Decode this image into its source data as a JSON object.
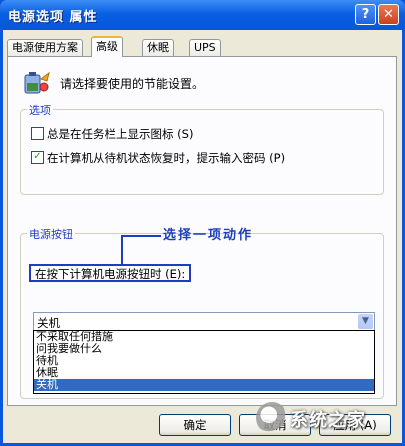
{
  "window": {
    "title": "电源选项 属性"
  },
  "tabs": [
    "电源使用方案",
    "高级",
    "休眠",
    "UPS"
  ],
  "active_tab": 1,
  "intro_text": "请选择要使用的节能设置。",
  "options_group": {
    "title": "选项",
    "items": [
      {
        "label": "总是在任务栏上显示图标 (S)",
        "checked": false,
        "mark": ""
      },
      {
        "label": "在计算机从待机状态恢复时，提示输入密码 (P)",
        "checked": true,
        "mark": "✓"
      }
    ]
  },
  "power_button_group": {
    "title": "电源按钮",
    "annotation": "选择一项动作",
    "label": "在按下计算机电源按钮时 (E):",
    "selected_value": "关机",
    "options": [
      "不采取任何措施",
      "问我要做什么",
      "待机",
      "休眠",
      "关机"
    ],
    "selected_index": 4
  },
  "buttons": {
    "ok": "确定",
    "cancel": "取消",
    "apply": "应用 (A)"
  },
  "watermark": "系统之家",
  "colors": {
    "accent": "#1f3ebf",
    "selection": "#316ac5",
    "titlebar": "#0a5fe2"
  }
}
